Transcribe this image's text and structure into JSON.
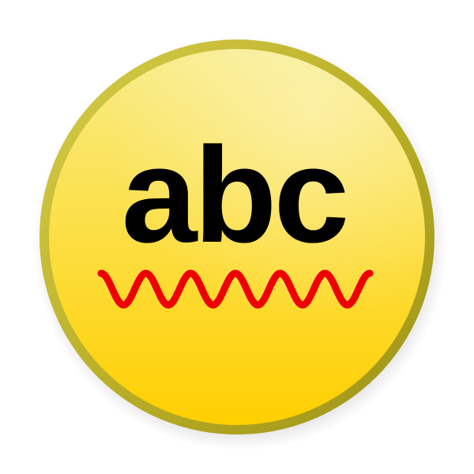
{
  "icon": {
    "name": "spell-check-icon",
    "text": "abc",
    "colors": {
      "ring": "#b3a824",
      "ring_light": "#d8cf4a",
      "fill_top": "#f9ea7c",
      "fill_bottom": "#ffd200",
      "text": "#000000",
      "squiggle": "#ee0000"
    }
  }
}
